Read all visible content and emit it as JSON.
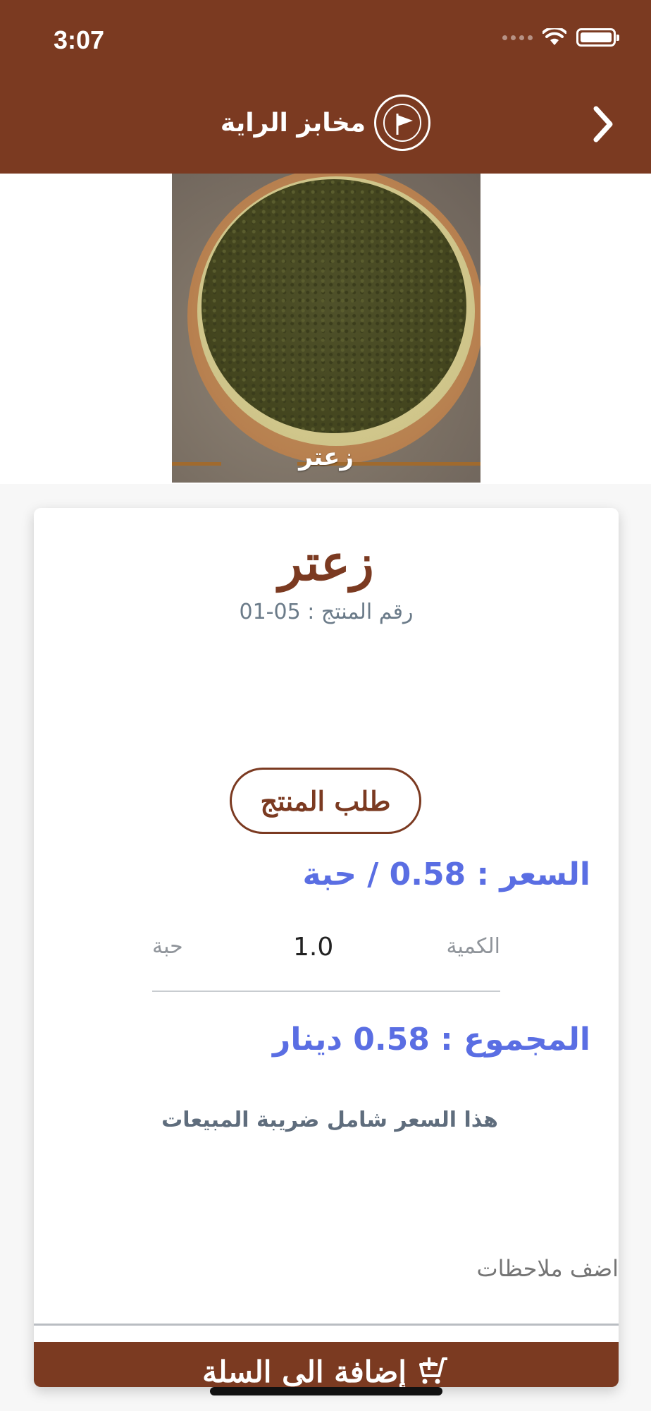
{
  "status_bar": {
    "time": "3:07"
  },
  "nav": {
    "title": "مخابز الراية",
    "back_icon": "chevron-right-icon"
  },
  "hero": {
    "caption": "زعتر"
  },
  "product": {
    "name": "زعتر",
    "code_text": "رقم المنتج : 05-01",
    "order_button": "طلب المنتج",
    "price_text": "السعر : 0.58 / حبة",
    "quantity_label": "الكمية",
    "quantity_value": "1.0",
    "quantity_unit": "حبة",
    "total_text": "المجموع : 0.58 دينار",
    "tax_note": "هذا السعر شامل ضريبة المبيعات",
    "notes_placeholder": "اضف ملاحظات",
    "add_to_cart": "إضافة الى السلة"
  },
  "colors": {
    "brand": "#7b3a21",
    "accent": "#5a6ee3"
  }
}
